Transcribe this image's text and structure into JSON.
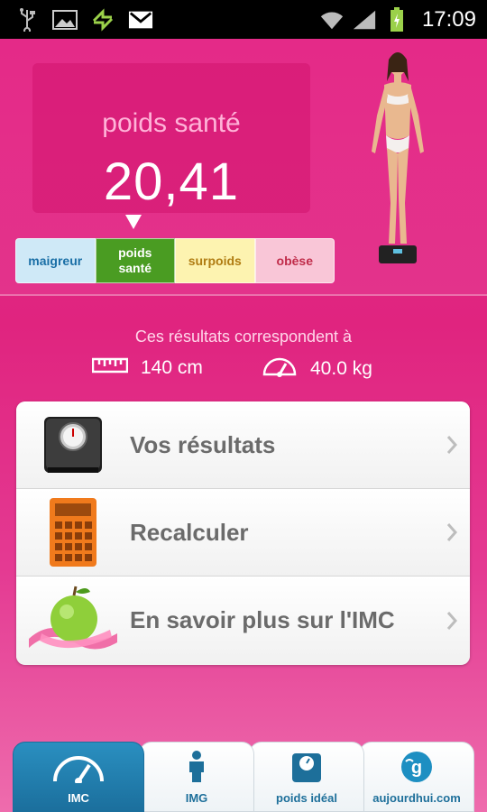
{
  "status_bar": {
    "time": "17:09",
    "icons": [
      "usb-icon",
      "image-icon",
      "sync-icon",
      "gmail-icon",
      "wifi-icon",
      "signal-icon",
      "battery-icon"
    ]
  },
  "result": {
    "category": "poids santé",
    "bmi": "20,41",
    "indicator_position": "poids santé"
  },
  "scale": {
    "segments": [
      {
        "label": "maigreur",
        "color": "#cfe9f7"
      },
      {
        "label": "poids\nsanté",
        "color": "#4a9c22"
      },
      {
        "label": "surpoids",
        "color": "#fdf3b0"
      },
      {
        "label": "obèse",
        "color": "#f9c6d7"
      }
    ]
  },
  "info": {
    "caption": "Ces résultats correspondent à",
    "height": "140 cm",
    "weight": "40.0 kg"
  },
  "menu": {
    "items": [
      {
        "label": "Vos résultats",
        "icon": "scale-icon"
      },
      {
        "label": "Recalculer",
        "icon": "calculator-icon"
      },
      {
        "label": "En savoir plus sur l'IMC",
        "icon": "apple-tape-icon"
      }
    ]
  },
  "tabs": [
    {
      "label": "IMC",
      "icon": "gauge-icon",
      "active": true
    },
    {
      "label": "IMG",
      "icon": "person-icon",
      "active": false
    },
    {
      "label": "poids idéal",
      "icon": "scale-icon",
      "active": false
    },
    {
      "label": "aujourdhui.com",
      "icon": "aujourdhui-logo-icon",
      "active": false
    }
  ],
  "colors": {
    "background": "#e42a88",
    "tab_active": "#1b6f9d",
    "menu_text": "#6b6b6b"
  }
}
